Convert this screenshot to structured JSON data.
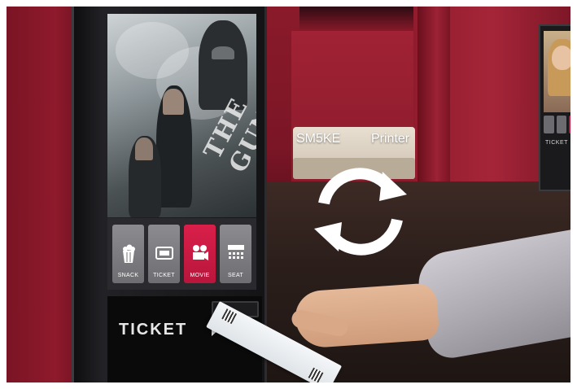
{
  "overlay": {
    "left_label": "SM5KE",
    "right_label": "Printer",
    "sync_icon": "sync-arrows-icon"
  },
  "kiosk": {
    "movie_title": "THE GUN",
    "menu": [
      {
        "label": "SNACK",
        "icon": "popcorn-icon",
        "active": false
      },
      {
        "label": "TICKET",
        "icon": "ticket-icon",
        "active": false
      },
      {
        "label": "MOVIE",
        "icon": "camera-icon",
        "active": true
      },
      {
        "label": "SEAT",
        "icon": "seat-icon",
        "active": false
      }
    ],
    "ticket_label": "TICKET",
    "accent_color": "#c2183d"
  },
  "far_kiosk": {
    "label": "TICKET"
  }
}
